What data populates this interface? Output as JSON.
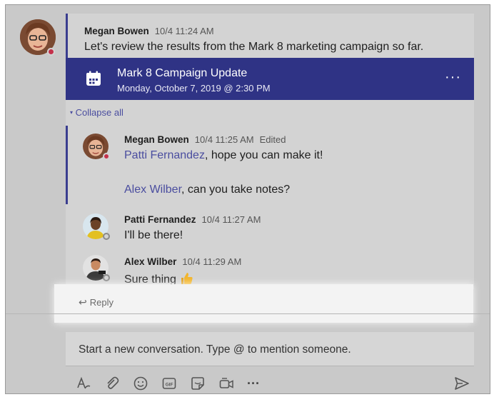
{
  "main_post": {
    "author": "Megan Bowen",
    "time": "10/4 11:24 AM",
    "text": "Let's review the results from the Mark 8 marketing campaign so far."
  },
  "meeting": {
    "title": "Mark 8 Campaign Update",
    "date": "Monday, October 7, 2019 @ 2:30 PM",
    "more": "···"
  },
  "collapse_label": "Collapse all",
  "replies": [
    {
      "author": "Megan Bowen",
      "time": "10/4 11:25 AM",
      "edited": "Edited",
      "line1_mention": "Patti Fernandez",
      "line1_rest": ", hope you can make it!",
      "line2_mention": "Alex Wilber",
      "line2_rest": ", can you take notes?"
    },
    {
      "author": "Patti Fernandez",
      "time": "10/4 11:27 AM",
      "text": "I'll be there!"
    },
    {
      "author": "Alex Wilber",
      "time": "10/4 11:29 AM",
      "text": "Sure thing"
    }
  ],
  "reply_label": "Reply",
  "compose_placeholder": "Start a new conversation. Type @ to mention someone.",
  "toolbar_icons": [
    "format-icon",
    "attach-icon",
    "emoji-icon",
    "gif-icon",
    "sticker-icon",
    "meet-now-icon",
    "more-options-icon",
    "send-icon"
  ],
  "colors": {
    "accent": "#2f3385",
    "mention": "#4a4d9f",
    "busy": "#c4314b"
  }
}
